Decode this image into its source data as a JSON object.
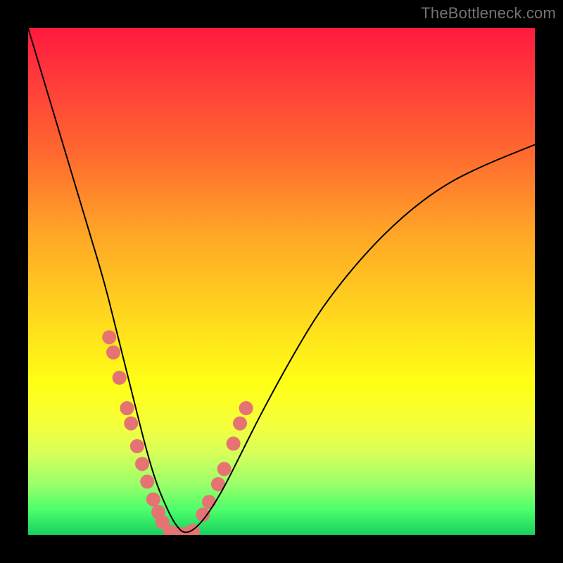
{
  "watermark": "TheBottleneck.com",
  "chart_data": {
    "type": "line",
    "title": "",
    "xlabel": "",
    "ylabel": "",
    "xlim": [
      0,
      100
    ],
    "ylim": [
      0,
      100
    ],
    "grid": false,
    "background_gradient": [
      "#ff1a3f",
      "#ff6a2f",
      "#ffd21f",
      "#ffff15",
      "#9aff6a",
      "#18d060"
    ],
    "series": [
      {
        "name": "bottleneck-curve",
        "x": [
          0,
          3,
          6,
          9,
          12,
          15,
          17,
          19,
          21,
          23,
          25,
          27,
          29,
          31,
          34,
          38,
          42,
          46,
          52,
          58,
          66,
          74,
          82,
          90,
          100
        ],
        "y": [
          100,
          90,
          80,
          70,
          60,
          50,
          42,
          34,
          26,
          18,
          11,
          6,
          2,
          0,
          2,
          8,
          16,
          24,
          35,
          45,
          55,
          63,
          69,
          73,
          77
        ],
        "stroke": "#000000",
        "stroke_width": 2
      },
      {
        "name": "highlight-dots-left",
        "type": "scatter",
        "x": [
          16.0,
          16.8,
          18.0,
          19.5,
          20.3,
          21.5,
          22.5,
          23.5,
          24.7,
          25.7,
          26.5
        ],
        "y": [
          39.0,
          36.0,
          31.0,
          25.0,
          22.0,
          17.5,
          14.0,
          10.5,
          7.0,
          4.5,
          2.5
        ],
        "color": "#e57373",
        "radius": 10
      },
      {
        "name": "highlight-dots-bottom",
        "type": "scatter",
        "x": [
          28.0,
          29.5,
          31.0,
          32.5
        ],
        "y": [
          0.6,
          0.2,
          0.2,
          0.8
        ],
        "color": "#e57373",
        "radius": 10
      },
      {
        "name": "highlight-dots-right",
        "type": "scatter",
        "x": [
          34.5,
          35.7,
          37.5,
          38.7,
          40.5,
          41.8,
          43.0
        ],
        "y": [
          4.0,
          6.5,
          10.0,
          13.0,
          18.0,
          22.0,
          25.0
        ],
        "color": "#e57373",
        "radius": 10
      }
    ]
  }
}
